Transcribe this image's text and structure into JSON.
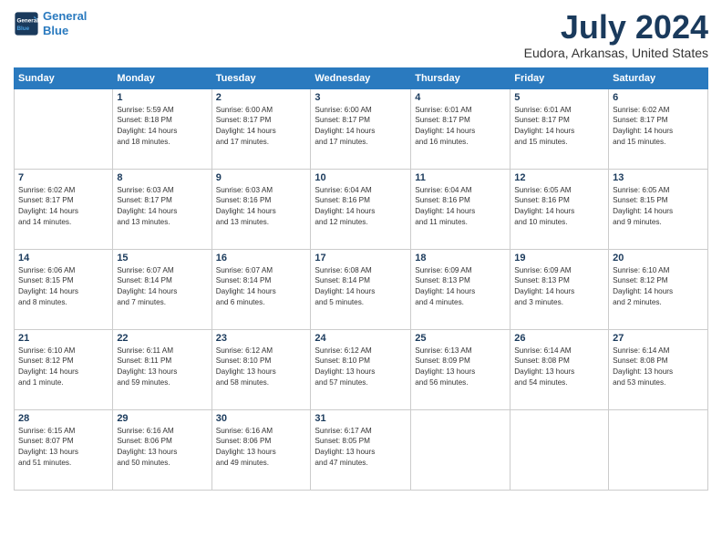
{
  "logo": {
    "line1": "General",
    "line2": "Blue"
  },
  "title": "July 2024",
  "location": "Eudora, Arkansas, United States",
  "days_header": [
    "Sunday",
    "Monday",
    "Tuesday",
    "Wednesday",
    "Thursday",
    "Friday",
    "Saturday"
  ],
  "weeks": [
    [
      {
        "day": "",
        "info": ""
      },
      {
        "day": "1",
        "info": "Sunrise: 5:59 AM\nSunset: 8:18 PM\nDaylight: 14 hours\nand 18 minutes."
      },
      {
        "day": "2",
        "info": "Sunrise: 6:00 AM\nSunset: 8:17 PM\nDaylight: 14 hours\nand 17 minutes."
      },
      {
        "day": "3",
        "info": "Sunrise: 6:00 AM\nSunset: 8:17 PM\nDaylight: 14 hours\nand 17 minutes."
      },
      {
        "day": "4",
        "info": "Sunrise: 6:01 AM\nSunset: 8:17 PM\nDaylight: 14 hours\nand 16 minutes."
      },
      {
        "day": "5",
        "info": "Sunrise: 6:01 AM\nSunset: 8:17 PM\nDaylight: 14 hours\nand 15 minutes."
      },
      {
        "day": "6",
        "info": "Sunrise: 6:02 AM\nSunset: 8:17 PM\nDaylight: 14 hours\nand 15 minutes."
      }
    ],
    [
      {
        "day": "7",
        "info": "Sunrise: 6:02 AM\nSunset: 8:17 PM\nDaylight: 14 hours\nand 14 minutes."
      },
      {
        "day": "8",
        "info": "Sunrise: 6:03 AM\nSunset: 8:17 PM\nDaylight: 14 hours\nand 13 minutes."
      },
      {
        "day": "9",
        "info": "Sunrise: 6:03 AM\nSunset: 8:16 PM\nDaylight: 14 hours\nand 13 minutes."
      },
      {
        "day": "10",
        "info": "Sunrise: 6:04 AM\nSunset: 8:16 PM\nDaylight: 14 hours\nand 12 minutes."
      },
      {
        "day": "11",
        "info": "Sunrise: 6:04 AM\nSunset: 8:16 PM\nDaylight: 14 hours\nand 11 minutes."
      },
      {
        "day": "12",
        "info": "Sunrise: 6:05 AM\nSunset: 8:16 PM\nDaylight: 14 hours\nand 10 minutes."
      },
      {
        "day": "13",
        "info": "Sunrise: 6:05 AM\nSunset: 8:15 PM\nDaylight: 14 hours\nand 9 minutes."
      }
    ],
    [
      {
        "day": "14",
        "info": "Sunrise: 6:06 AM\nSunset: 8:15 PM\nDaylight: 14 hours\nand 8 minutes."
      },
      {
        "day": "15",
        "info": "Sunrise: 6:07 AM\nSunset: 8:14 PM\nDaylight: 14 hours\nand 7 minutes."
      },
      {
        "day": "16",
        "info": "Sunrise: 6:07 AM\nSunset: 8:14 PM\nDaylight: 14 hours\nand 6 minutes."
      },
      {
        "day": "17",
        "info": "Sunrise: 6:08 AM\nSunset: 8:14 PM\nDaylight: 14 hours\nand 5 minutes."
      },
      {
        "day": "18",
        "info": "Sunrise: 6:09 AM\nSunset: 8:13 PM\nDaylight: 14 hours\nand 4 minutes."
      },
      {
        "day": "19",
        "info": "Sunrise: 6:09 AM\nSunset: 8:13 PM\nDaylight: 14 hours\nand 3 minutes."
      },
      {
        "day": "20",
        "info": "Sunrise: 6:10 AM\nSunset: 8:12 PM\nDaylight: 14 hours\nand 2 minutes."
      }
    ],
    [
      {
        "day": "21",
        "info": "Sunrise: 6:10 AM\nSunset: 8:12 PM\nDaylight: 14 hours\nand 1 minute."
      },
      {
        "day": "22",
        "info": "Sunrise: 6:11 AM\nSunset: 8:11 PM\nDaylight: 13 hours\nand 59 minutes."
      },
      {
        "day": "23",
        "info": "Sunrise: 6:12 AM\nSunset: 8:10 PM\nDaylight: 13 hours\nand 58 minutes."
      },
      {
        "day": "24",
        "info": "Sunrise: 6:12 AM\nSunset: 8:10 PM\nDaylight: 13 hours\nand 57 minutes."
      },
      {
        "day": "25",
        "info": "Sunrise: 6:13 AM\nSunset: 8:09 PM\nDaylight: 13 hours\nand 56 minutes."
      },
      {
        "day": "26",
        "info": "Sunrise: 6:14 AM\nSunset: 8:08 PM\nDaylight: 13 hours\nand 54 minutes."
      },
      {
        "day": "27",
        "info": "Sunrise: 6:14 AM\nSunset: 8:08 PM\nDaylight: 13 hours\nand 53 minutes."
      }
    ],
    [
      {
        "day": "28",
        "info": "Sunrise: 6:15 AM\nSunset: 8:07 PM\nDaylight: 13 hours\nand 51 minutes."
      },
      {
        "day": "29",
        "info": "Sunrise: 6:16 AM\nSunset: 8:06 PM\nDaylight: 13 hours\nand 50 minutes."
      },
      {
        "day": "30",
        "info": "Sunrise: 6:16 AM\nSunset: 8:06 PM\nDaylight: 13 hours\nand 49 minutes."
      },
      {
        "day": "31",
        "info": "Sunrise: 6:17 AM\nSunset: 8:05 PM\nDaylight: 13 hours\nand 47 minutes."
      },
      {
        "day": "",
        "info": ""
      },
      {
        "day": "",
        "info": ""
      },
      {
        "day": "",
        "info": ""
      }
    ]
  ]
}
